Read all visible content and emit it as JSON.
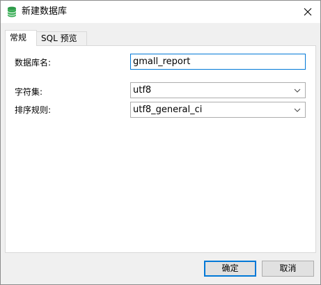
{
  "window": {
    "title": "新建数据库",
    "icon": "database-icon",
    "close_icon": "close-icon"
  },
  "tabs": [
    {
      "label": "常规",
      "active": true
    },
    {
      "label": "SQL 预览",
      "active": false
    }
  ],
  "form": {
    "db_name_label": "数据库名:",
    "db_name_value": "gmall_report",
    "charset_label": "字符集:",
    "charset_value": "utf8",
    "collation_label": "排序规则:",
    "collation_value": "utf8_general_ci"
  },
  "buttons": {
    "ok_label": "确定",
    "cancel_label": "取消"
  },
  "colors": {
    "accent": "#0078d7",
    "icon_green": "#2e9b4a",
    "window_bg": "#f0f0f0",
    "panel_bg": "#ffffff"
  }
}
